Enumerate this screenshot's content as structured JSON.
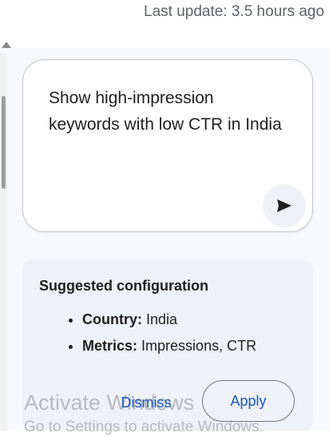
{
  "header": {
    "last_update": "Last update: 3.5 hours ago"
  },
  "prompt": {
    "text": "Show high-impression keywords with low CTR in India",
    "send_icon": "send-icon"
  },
  "suggestion": {
    "title": "Suggested configuration",
    "items": [
      {
        "key": "Country:",
        "value": "India"
      },
      {
        "key": "Metrics:",
        "value": "Impressions, CTR"
      }
    ],
    "dismiss_label": "Dismiss",
    "apply_label": "Apply"
  },
  "watermark": {
    "title": "Activate Windows",
    "subtitle": "Go to Settings to activate Windows."
  },
  "colors": {
    "accent": "#1a56c4",
    "card_bg": "#eef1f6",
    "border": "#c4c7c5"
  }
}
